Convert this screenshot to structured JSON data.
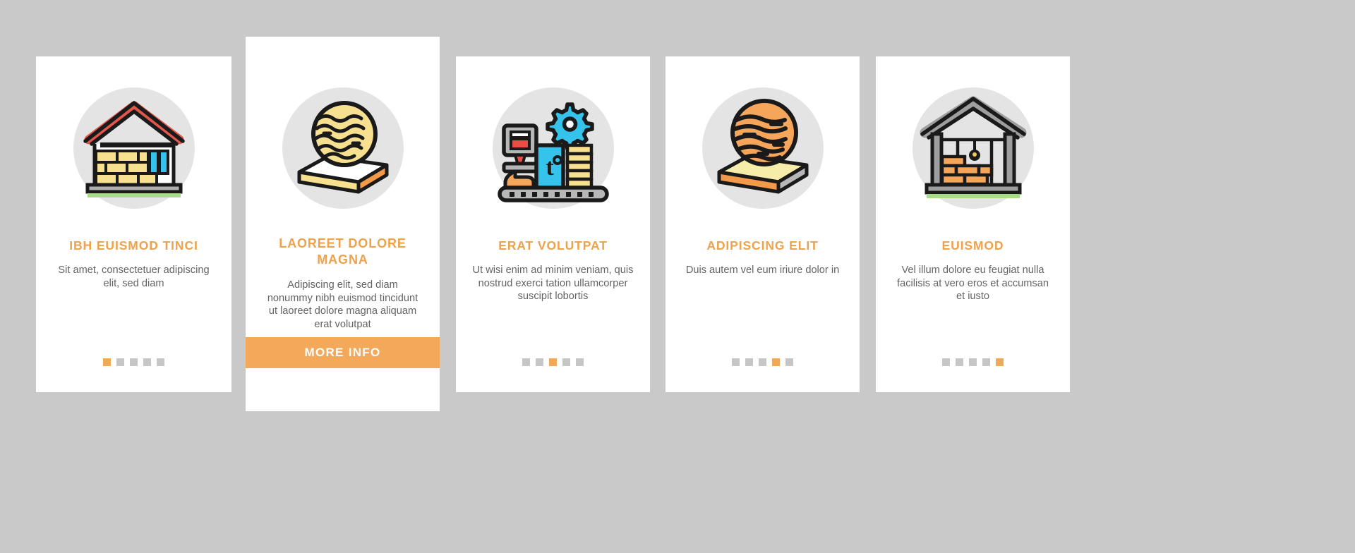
{
  "theme": {
    "page_background": "#c9c9c9",
    "card_background": "#ffffff",
    "accent": "#eda24b",
    "button_background": "#f4a95a",
    "body_text": "#636363",
    "dot_inactive": "#c6c6c6",
    "dot_active": "#f0a957",
    "icon_disc": "#e4e4e4"
  },
  "cards": [
    {
      "icon_name": "brick-wall-house-icon",
      "title": "IBH EUISMOD TINCI",
      "body": "Sit amet, consectetuer adipiscing elit, sed diam",
      "dots": {
        "count": 5,
        "active_index": 0
      },
      "has_button": false
    },
    {
      "icon_name": "wood-grain-magnifier-plank-icon",
      "title": "LAOREET DOLORE MAGNA",
      "body": "Adipiscing elit, sed diam nonummy nibh euismod tincidunt ut laoreet dolore magna aliquam erat volutpat",
      "dots": {
        "count": 5,
        "active_index": 1
      },
      "has_button": true,
      "button_label": "MORE INFO"
    },
    {
      "icon_name": "brick-production-machine-icon",
      "title": "ERAT VOLUTPAT",
      "body": "Ut wisi enim ad minim veniam, quis nostrud exerci tation ullamcorper suscipit lobortis",
      "dots": {
        "count": 5,
        "active_index": 2
      },
      "has_button": false
    },
    {
      "icon_name": "wood-texture-slab-icon",
      "title": "ADIPISCING ELIT",
      "body": "Duis autem vel eum iriure dolor in",
      "dots": {
        "count": 5,
        "active_index": 3
      },
      "has_button": false
    },
    {
      "icon_name": "brick-warehouse-storage-icon",
      "title": "EUISMOD",
      "body": "Vel illum dolore eu feugiat nulla facilisis at vero eros et accumsan et iusto",
      "dots": {
        "count": 5,
        "active_index": 4
      },
      "has_button": false
    }
  ]
}
